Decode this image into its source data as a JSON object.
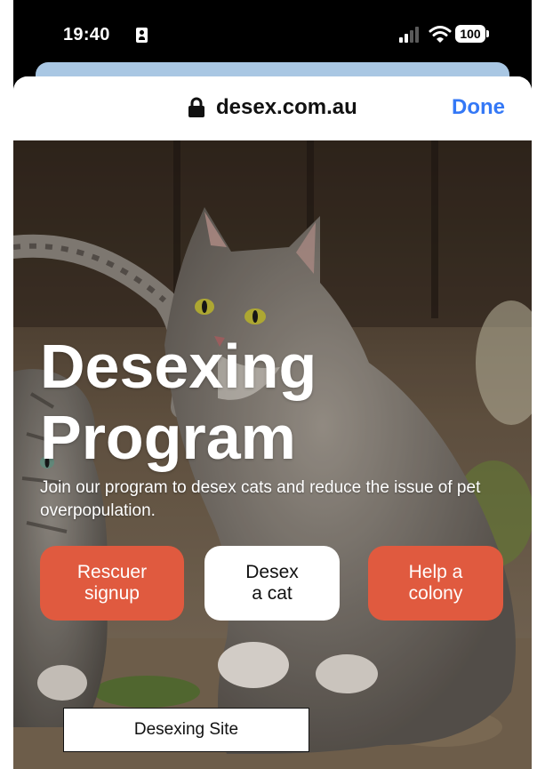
{
  "status_bar": {
    "time": "19:40",
    "battery_level": "100",
    "icons": [
      "contact-card-icon",
      "signal-icon",
      "wifi-icon",
      "battery-icon"
    ]
  },
  "browser": {
    "domain": "desex.com.au",
    "done_label": "Done",
    "icons": [
      "lock-icon"
    ]
  },
  "hero": {
    "headline_line1": "Desexing",
    "headline_line2": "Program",
    "tagline": "Join our program to desex cats and reduce the issue of pet overpopulation.",
    "buttons": [
      {
        "label": "Rescuer\nsignup",
        "style": "orange"
      },
      {
        "label": "Desex\na cat",
        "style": "white"
      },
      {
        "label": "Help a\ncolony",
        "style": "orange"
      }
    ]
  },
  "footer_label": "Desexing Site",
  "colors": {
    "accent_orange": "#e05a3f",
    "link_blue": "#3478f6",
    "underlay_blue": "#a9c7e3"
  }
}
